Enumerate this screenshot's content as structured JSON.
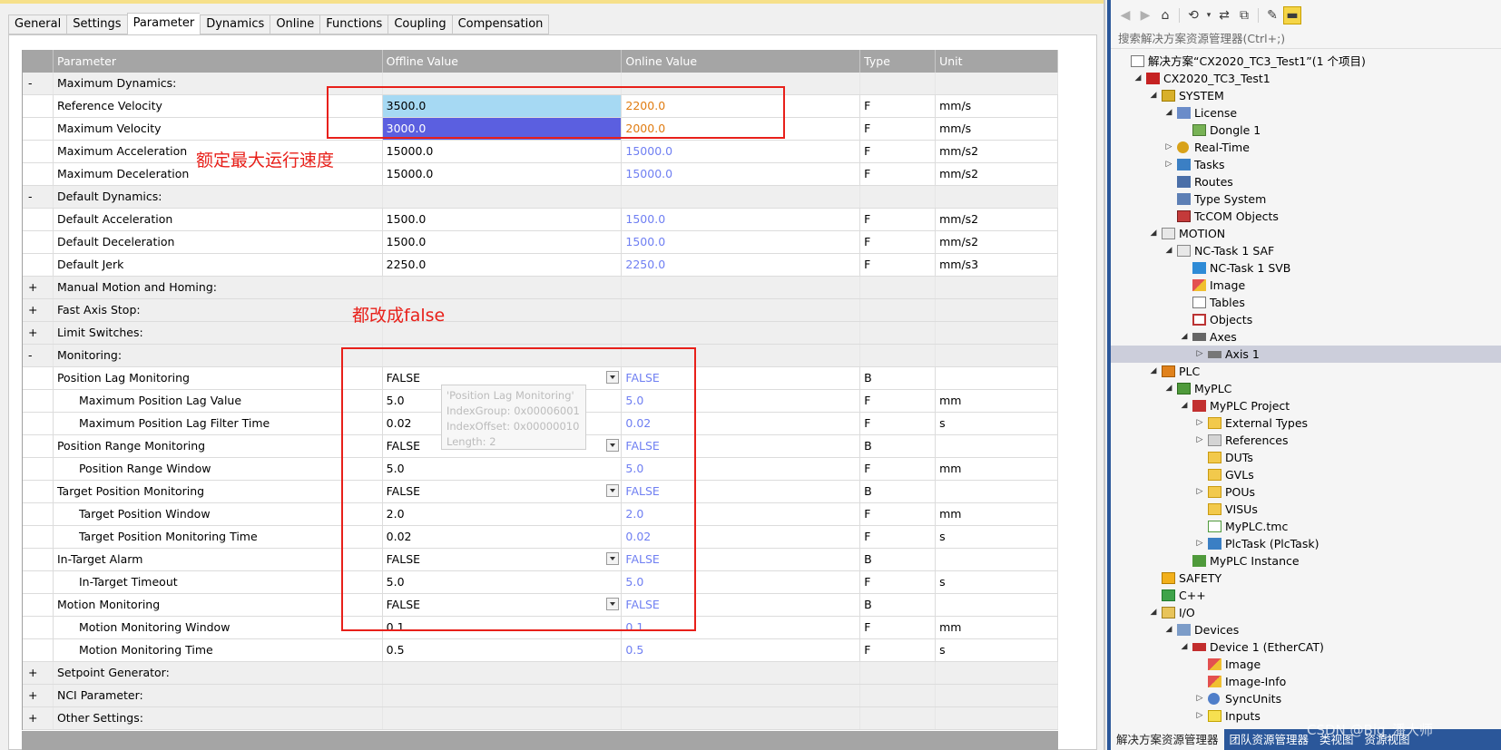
{
  "tabs": [
    "General",
    "Settings",
    "Parameter",
    "Dynamics",
    "Online",
    "Functions",
    "Coupling",
    "Compensation"
  ],
  "active_tab": "Parameter",
  "grid": {
    "headers": [
      "",
      "Parameter",
      "Offline Value",
      "Online Value",
      "Type",
      "Unit"
    ],
    "rows": [
      {
        "toggle": "-",
        "name": "Maximum Dynamics:",
        "group": true
      },
      {
        "toggle": "",
        "name": "Reference Velocity",
        "offline": "3500.0",
        "online": "2200.0",
        "type": "F",
        "unit": "mm/s"
      },
      {
        "toggle": "",
        "name": "Maximum Velocity",
        "offline": "3000.0",
        "online": "2000.0",
        "type": "F",
        "unit": "mm/s"
      },
      {
        "toggle": "",
        "name": "Maximum Acceleration",
        "offline": "15000.0",
        "online": "15000.0",
        "type": "F",
        "unit": "mm/s2"
      },
      {
        "toggle": "",
        "name": "Maximum Deceleration",
        "offline": "15000.0",
        "online": "15000.0",
        "type": "F",
        "unit": "mm/s2"
      },
      {
        "toggle": "-",
        "name": "Default Dynamics:",
        "group": true
      },
      {
        "toggle": "",
        "name": "Default Acceleration",
        "offline": "1500.0",
        "online": "1500.0",
        "type": "F",
        "unit": "mm/s2"
      },
      {
        "toggle": "",
        "name": "Default Deceleration",
        "offline": "1500.0",
        "online": "1500.0",
        "type": "F",
        "unit": "mm/s2"
      },
      {
        "toggle": "",
        "name": "Default Jerk",
        "offline": "2250.0",
        "online": "2250.0",
        "type": "F",
        "unit": "mm/s3"
      },
      {
        "toggle": "+",
        "name": "Manual Motion and Homing:",
        "group": true
      },
      {
        "toggle": "+",
        "name": "Fast Axis Stop:",
        "group": true
      },
      {
        "toggle": "+",
        "name": "Limit Switches:",
        "group": true
      },
      {
        "toggle": "-",
        "name": "Monitoring:",
        "group": true
      },
      {
        "toggle": "",
        "name": "Position Lag Monitoring",
        "offline": "FALSE",
        "online": "FALSE",
        "type": "B",
        "unit": ""
      },
      {
        "toggle": "",
        "name": "Maximum Position Lag Value",
        "offline": "5.0",
        "online": "5.0",
        "type": "F",
        "unit": "mm"
      },
      {
        "toggle": "",
        "name": "Maximum Position Lag Filter Time",
        "offline": "0.02",
        "online": "0.02",
        "type": "F",
        "unit": "s"
      },
      {
        "toggle": "",
        "name": "Position Range Monitoring",
        "offline": "FALSE",
        "online": "FALSE",
        "type": "B",
        "unit": ""
      },
      {
        "toggle": "",
        "name": "Position Range Window",
        "offline": "5.0",
        "online": "5.0",
        "type": "F",
        "unit": "mm"
      },
      {
        "toggle": "",
        "name": "Target Position Monitoring",
        "offline": "FALSE",
        "online": "FALSE",
        "type": "B",
        "unit": ""
      },
      {
        "toggle": "",
        "name": "Target Position Window",
        "offline": "2.0",
        "online": "2.0",
        "type": "F",
        "unit": "mm"
      },
      {
        "toggle": "",
        "name": "Target Position Monitoring Time",
        "offline": "0.02",
        "online": "0.02",
        "type": "F",
        "unit": "s"
      },
      {
        "toggle": "",
        "name": "In-Target Alarm",
        "offline": "FALSE",
        "online": "FALSE",
        "type": "B",
        "unit": ""
      },
      {
        "toggle": "",
        "name": "In-Target Timeout",
        "offline": "5.0",
        "online": "5.0",
        "type": "F",
        "unit": "s"
      },
      {
        "toggle": "",
        "name": "Motion Monitoring",
        "offline": "FALSE",
        "online": "FALSE",
        "type": "B",
        "unit": ""
      },
      {
        "toggle": "",
        "name": "Motion Monitoring Window",
        "offline": "0.1",
        "online": "0.1",
        "type": "F",
        "unit": "mm"
      },
      {
        "toggle": "",
        "name": "Motion Monitoring Time",
        "offline": "0.5",
        "online": "0.5",
        "type": "F",
        "unit": "s"
      },
      {
        "toggle": "+",
        "name": "Setpoint Generator:",
        "group": true
      },
      {
        "toggle": "+",
        "name": "NCI Parameter:",
        "group": true
      },
      {
        "toggle": "+",
        "name": "Other Settings:",
        "group": true
      }
    ]
  },
  "annotations": {
    "rated_speed": "额定最大运行速度",
    "set_false": "都改成false"
  },
  "tooltip": {
    "title": "'Position Lag Monitoring'",
    "index_group": "IndexGroup:  0x00006001",
    "index_offset": "IndexOffset: 0x00000010",
    "length": "Length:          2"
  },
  "solution_explorer": {
    "search_placeholder": "搜索解决方案资源管理器(Ctrl+;)",
    "tree": [
      {
        "label": "解决方案“CX2020_TC3_Test1”(1 个项目)",
        "level": 0,
        "arrow": "",
        "icon": "solution-icon"
      },
      {
        "label": "CX2020_TC3_Test1",
        "level": 1,
        "arrow": "◢",
        "icon": "project-icon"
      },
      {
        "label": "SYSTEM",
        "level": 2,
        "arrow": "◢",
        "icon": "system-icon"
      },
      {
        "label": "License",
        "level": 3,
        "arrow": "◢",
        "icon": "license-icon"
      },
      {
        "label": "Dongle 1",
        "level": 4,
        "arrow": "",
        "icon": "dongle-icon"
      },
      {
        "label": "Real-Time",
        "level": 3,
        "arrow": "▷",
        "icon": "realtime-icon"
      },
      {
        "label": "Tasks",
        "level": 3,
        "arrow": "▷",
        "icon": "tasks-icon"
      },
      {
        "label": "Routes",
        "level": 3,
        "arrow": "",
        "icon": "routes-icon"
      },
      {
        "label": "Type System",
        "level": 3,
        "arrow": "",
        "icon": "type-system-icon"
      },
      {
        "label": "TcCOM Objects",
        "level": 3,
        "arrow": "",
        "icon": "tccom-icon"
      },
      {
        "label": "MOTION",
        "level": 2,
        "arrow": "◢",
        "icon": "motion-icon"
      },
      {
        "label": "NC-Task 1 SAF",
        "level": 3,
        "arrow": "◢",
        "icon": "nc-task-icon"
      },
      {
        "label": "NC-Task 1 SVB",
        "level": 4,
        "arrow": "",
        "icon": "svb-icon"
      },
      {
        "label": "Image",
        "level": 4,
        "arrow": "",
        "icon": "image-icon"
      },
      {
        "label": "Tables",
        "level": 4,
        "arrow": "",
        "icon": "tables-icon"
      },
      {
        "label": "Objects",
        "level": 4,
        "arrow": "",
        "icon": "objects-icon"
      },
      {
        "label": "Axes",
        "level": 4,
        "arrow": "◢",
        "icon": "axes-icon"
      },
      {
        "label": "Axis 1",
        "level": 5,
        "arrow": "▷",
        "icon": "axis-icon",
        "selected": true
      },
      {
        "label": "PLC",
        "level": 2,
        "arrow": "◢",
        "icon": "plc-icon"
      },
      {
        "label": "MyPLC",
        "level": 3,
        "arrow": "◢",
        "icon": "myplc-icon"
      },
      {
        "label": "MyPLC Project",
        "level": 4,
        "arrow": "◢",
        "icon": "plc-project-icon"
      },
      {
        "label": "External Types",
        "level": 5,
        "arrow": "▷",
        "icon": "folder-icon"
      },
      {
        "label": "References",
        "level": 5,
        "arrow": "▷",
        "icon": "references-icon"
      },
      {
        "label": "DUTs",
        "level": 5,
        "arrow": "",
        "icon": "folder-icon"
      },
      {
        "label": "GVLs",
        "level": 5,
        "arrow": "",
        "icon": "folder-icon"
      },
      {
        "label": "POUs",
        "level": 5,
        "arrow": "▷",
        "icon": "folder-icon"
      },
      {
        "label": "VISUs",
        "level": 5,
        "arrow": "",
        "icon": "folder-icon"
      },
      {
        "label": "MyPLC.tmc",
        "level": 5,
        "arrow": "",
        "icon": "tmc-icon"
      },
      {
        "label": "PlcTask (PlcTask)",
        "level": 5,
        "arrow": "▷",
        "icon": "plctask-icon"
      },
      {
        "label": "MyPLC Instance",
        "level": 4,
        "arrow": "",
        "icon": "instance-icon"
      },
      {
        "label": "SAFETY",
        "level": 2,
        "arrow": "",
        "icon": "safety-icon"
      },
      {
        "label": "C++",
        "level": 2,
        "arrow": "",
        "icon": "cpp-icon"
      },
      {
        "label": "I/O",
        "level": 2,
        "arrow": "◢",
        "icon": "io-icon"
      },
      {
        "label": "Devices",
        "level": 3,
        "arrow": "◢",
        "icon": "devices-icon"
      },
      {
        "label": "Device 1 (EtherCAT)",
        "level": 4,
        "arrow": "◢",
        "icon": "ethercat-icon"
      },
      {
        "label": "Image",
        "level": 5,
        "arrow": "",
        "icon": "image-icon"
      },
      {
        "label": "Image-Info",
        "level": 5,
        "arrow": "",
        "icon": "image-icon"
      },
      {
        "label": "SyncUnits",
        "level": 5,
        "arrow": "▷",
        "icon": "syncunits-icon"
      },
      {
        "label": "Inputs",
        "level": 5,
        "arrow": "▷",
        "icon": "inputs-icon"
      }
    ],
    "bottom_tabs": [
      "解决方案资源管理器",
      "团队资源管理器",
      "类视图",
      "资源视图"
    ]
  },
  "watermark": "CSDN @Big_潘大师",
  "colors": {
    "accent_blue": "#2b579a",
    "annotation_red": "#e8201a",
    "online_value": "#6f7ff2",
    "online_changed": "#e07c12",
    "cell_highlight_light": "#a6d9f3",
    "cell_highlight_selected": "#5b5fe0"
  }
}
